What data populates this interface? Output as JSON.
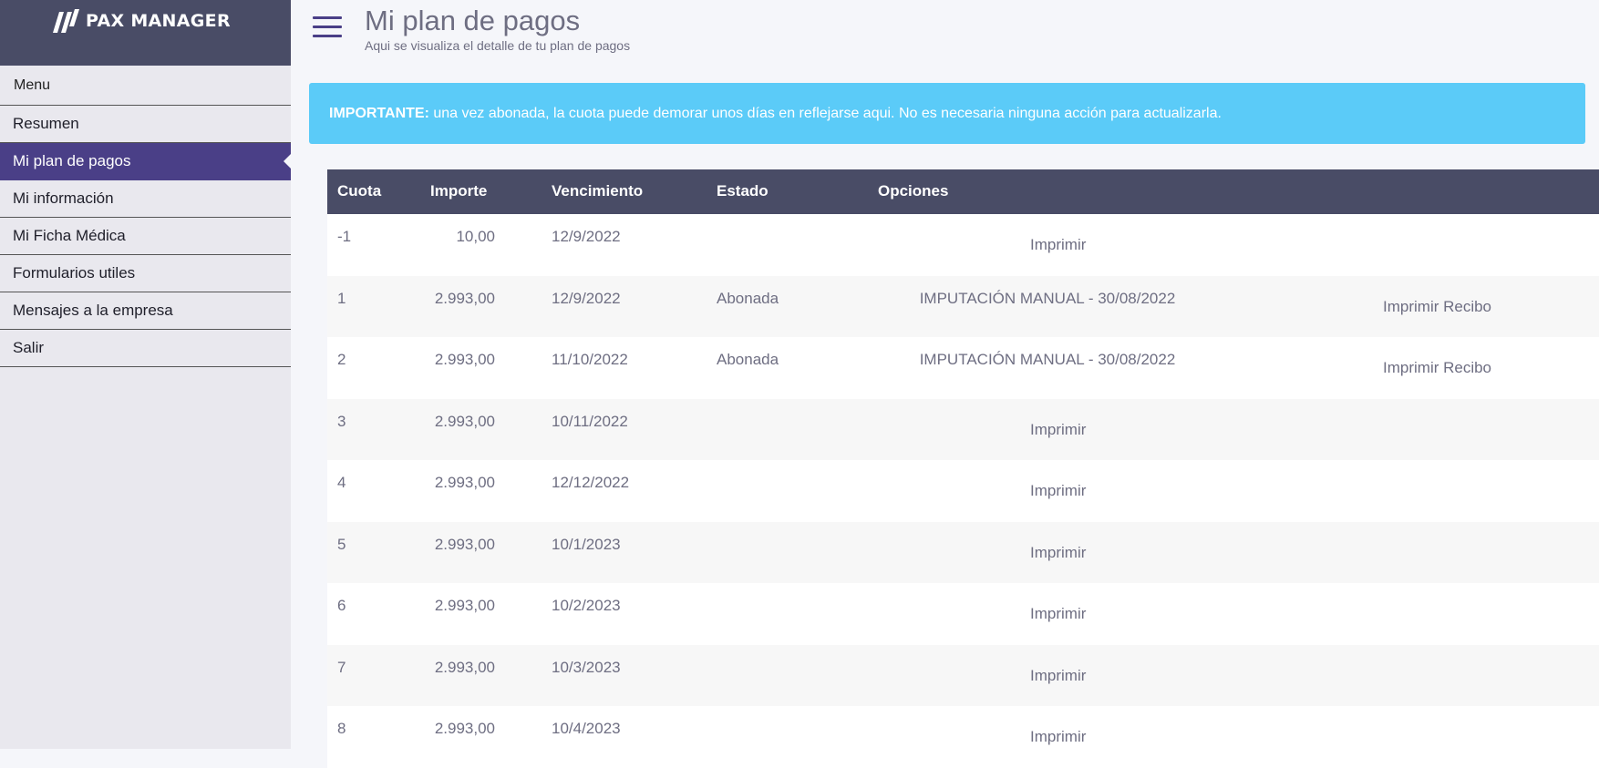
{
  "brand": {
    "name": "PAX MANAGER"
  },
  "sidebar": {
    "title": "Menu",
    "items": [
      {
        "label": "Resumen"
      },
      {
        "label": "Mi plan de pagos"
      },
      {
        "label": "Mi información"
      },
      {
        "label": "Mi Ficha Médica"
      },
      {
        "label": "Formularios utiles"
      },
      {
        "label": "Mensajes a la empresa"
      },
      {
        "label": "Salir"
      }
    ],
    "active_index": 1
  },
  "header": {
    "title": "Mi plan de pagos",
    "subtitle": "Aqui se visualiza el detalle de tu plan de pagos"
  },
  "alert": {
    "strong": "IMPORTANTE:",
    "text": " una vez abonada, la cuota puede demorar unos días en reflejarse aqui. No es necesaria ninguna acción para actualizarla."
  },
  "table": {
    "headers": [
      "Cuota",
      "Importe",
      "Vencimiento",
      "Estado",
      "Opciones"
    ],
    "rows": [
      {
        "cuota": "-1",
        "importe": "10,00",
        "vencimiento": "12/9/2022",
        "estado": "",
        "opcion": "",
        "accion": "Imprimir",
        "recibo": ""
      },
      {
        "cuota": "1",
        "importe": "2.993,00",
        "vencimiento": "12/9/2022",
        "estado": "Abonada",
        "opcion": "IMPUTACIÓN MANUAL - 30/08/2022",
        "accion": "",
        "recibo": "Imprimir Recibo"
      },
      {
        "cuota": "2",
        "importe": "2.993,00",
        "vencimiento": "11/10/2022",
        "estado": "Abonada",
        "opcion": "IMPUTACIÓN MANUAL - 30/08/2022",
        "accion": "",
        "recibo": "Imprimir Recibo"
      },
      {
        "cuota": "3",
        "importe": "2.993,00",
        "vencimiento": "10/11/2022",
        "estado": "",
        "opcion": "",
        "accion": "Imprimir",
        "recibo": ""
      },
      {
        "cuota": "4",
        "importe": "2.993,00",
        "vencimiento": "12/12/2022",
        "estado": "",
        "opcion": "",
        "accion": "Imprimir",
        "recibo": ""
      },
      {
        "cuota": "5",
        "importe": "2.993,00",
        "vencimiento": "10/1/2023",
        "estado": "",
        "opcion": "",
        "accion": "Imprimir",
        "recibo": ""
      },
      {
        "cuota": "6",
        "importe": "2.993,00",
        "vencimiento": "10/2/2023",
        "estado": "",
        "opcion": "",
        "accion": "Imprimir",
        "recibo": ""
      },
      {
        "cuota": "7",
        "importe": "2.993,00",
        "vencimiento": "10/3/2023",
        "estado": "",
        "opcion": "",
        "accion": "Imprimir",
        "recibo": ""
      },
      {
        "cuota": "8",
        "importe": "2.993,00",
        "vencimiento": "10/4/2023",
        "estado": "",
        "opcion": "",
        "accion": "Imprimir",
        "recibo": ""
      }
    ]
  },
  "icons": {
    "menu": "hamburger-menu-icon",
    "logo": "pax-logo-icon"
  },
  "colors": {
    "sidebar_header": "#494c66",
    "active": "#4a3f87",
    "alert": "#5bcbf8",
    "table_header": "#494c66"
  }
}
